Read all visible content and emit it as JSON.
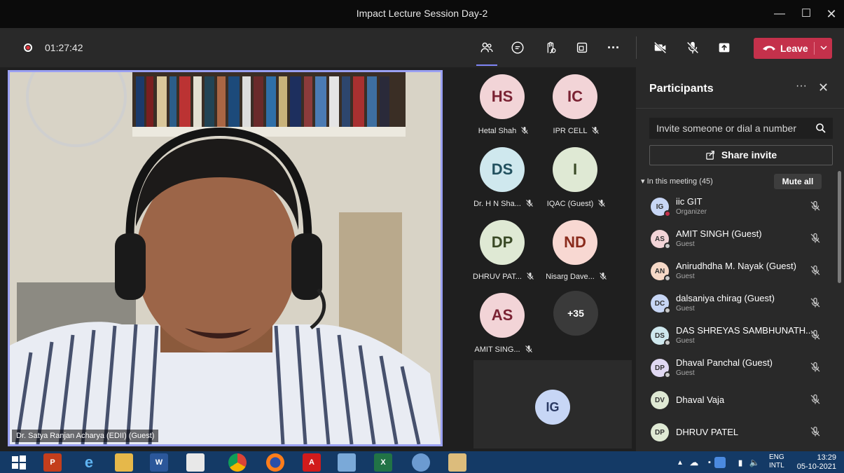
{
  "window": {
    "title": "Impact Lecture Session Day-2"
  },
  "toolbar": {
    "timer": "01:27:42",
    "leave_label": "Leave"
  },
  "video": {
    "name_tag": "Dr. Satya Ranjan Acharya (EDII) (Guest)"
  },
  "grid": {
    "tiles": [
      {
        "initials": "HS",
        "name": "Hetal Shah",
        "bg": "#f2d4d7",
        "fg": "#7a2233"
      },
      {
        "initials": "IC",
        "name": "IPR CELL",
        "bg": "#f2d4d7",
        "fg": "#7a2233"
      },
      {
        "initials": "DS",
        "name": "Dr. H N Sha...",
        "bg": "#cfe8ee",
        "fg": "#21505e"
      },
      {
        "initials": "I",
        "name": "IQAC (Guest)",
        "bg": "#dfe9d4",
        "fg": "#3a4a26"
      },
      {
        "initials": "DP",
        "name": "DHRUV PAT...",
        "bg": "#dfe9d4",
        "fg": "#3a4a26"
      },
      {
        "initials": "ND",
        "name": "Nisarg Dave...",
        "bg": "#f8d8d2",
        "fg": "#8a2b1c"
      },
      {
        "initials": "AS",
        "name": "AMIT SING...",
        "bg": "#f2d4d7",
        "fg": "#7a2233"
      }
    ],
    "overflow": "+35",
    "self_initials": "IG"
  },
  "participants": {
    "title": "Participants",
    "search_placeholder": "Invite someone or dial a number",
    "share_label": "Share invite",
    "section_label": "In this meeting (45)",
    "mute_all_label": "Mute all",
    "people": [
      {
        "initials": "IG",
        "name": "iic GIT",
        "role": "Organizer",
        "bg": "#c7d6f5",
        "status": "#c4314b"
      },
      {
        "initials": "AS",
        "name": "AMIT SINGH (Guest)",
        "role": "Guest",
        "bg": "#f2d4d7",
        "status": "#c8c8c8"
      },
      {
        "initials": "AN",
        "name": "Anirudhdha M. Nayak (Guest)",
        "role": "Guest",
        "bg": "#f6d9c7",
        "status": "#c8c8c8"
      },
      {
        "initials": "DC",
        "name": "dalsaniya chirag (Guest)",
        "role": "Guest",
        "bg": "#c7d6f5",
        "status": "#c8c8c8"
      },
      {
        "initials": "DS",
        "name": "DAS SHREYAS SAMBHUNATH...",
        "role": "Guest",
        "bg": "#cfe8ee",
        "status": "#c8c8c8"
      },
      {
        "initials": "DP",
        "name": "Dhaval Panchal (Guest)",
        "role": "Guest",
        "bg": "#e0d8f2",
        "status": "#c8c8c8"
      },
      {
        "initials": "DV",
        "name": "Dhaval Vaja",
        "role": "",
        "bg": "#dfe9d4",
        "status": ""
      },
      {
        "initials": "DP",
        "name": "DHRUV PATEL",
        "role": "",
        "bg": "#dfe9d4",
        "status": ""
      }
    ]
  },
  "taskbar": {
    "lang": "ENG",
    "layout": "INTL",
    "time": "13:29",
    "date": "05-10-2021"
  }
}
